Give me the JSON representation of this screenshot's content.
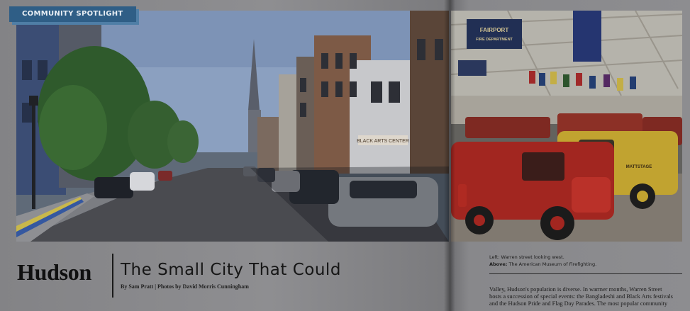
{
  "section_tag": "COMMUNITY SPOTLIGHT",
  "title": "Hudson",
  "subtitle": "The Small City That Could",
  "byline": "By Sam Pratt  |  Photos by David Morris Cunningham",
  "captions": {
    "left_label": "Left:",
    "left_text": " Warren street looking west.",
    "above_label": "Above:",
    "above_text": " The American Museum of Firefighting."
  },
  "body_lines": [
    "Valley, Hudson's population is diverse. In warmer months, Warren Street",
    "hosts a succession of special events: the Bangladeshi and Black Arts festivals",
    "and the Hudson Pride and Flag Day Parades. The most popular community"
  ],
  "photo_signs": {
    "banner_1": "FAIRPORT",
    "banner_2": "FIRE DEPARTMENT",
    "storefront": "BLACK ARTS CENTER",
    "truck_door": "MATTSTAGE"
  },
  "colors": {
    "tag_bg": "#2f5e86",
    "tag_shadow": "#4f7ea6",
    "text": "#101010"
  }
}
